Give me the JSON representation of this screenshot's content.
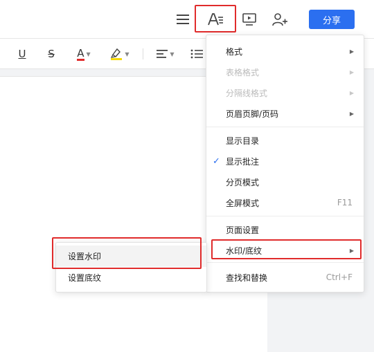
{
  "topbar": {
    "icons": [
      "menu-icon",
      "text-format-icon",
      "presentation-icon",
      "add-collaborator-icon"
    ],
    "share_label": "分享"
  },
  "format_toolbar": {
    "icons": [
      "underline-icon",
      "strikethrough-icon",
      "font-color-icon",
      "highlight-color-icon",
      "align-icon",
      "bullet-list-icon"
    ],
    "underline_glyph": "U",
    "strike_glyph": "S",
    "font_color_glyph": "A",
    "font_color": "#e02b2b",
    "highlight_color": "#f5d90a"
  },
  "menu": {
    "items": [
      {
        "label": "格式",
        "disabled": false,
        "submenu": true
      },
      {
        "label": "表格格式",
        "disabled": true,
        "submenu": true
      },
      {
        "label": "分隔线格式",
        "disabled": true,
        "submenu": true
      },
      {
        "label": "页眉页脚/页码",
        "disabled": false,
        "submenu": true
      },
      {
        "label": "显示目录",
        "disabled": false
      },
      {
        "label": "显示批注",
        "disabled": false,
        "checked": true
      },
      {
        "label": "分页模式",
        "disabled": false
      },
      {
        "label": "全屏模式",
        "disabled": false,
        "shortcut": "F11"
      },
      {
        "label": "页面设置",
        "disabled": false
      },
      {
        "label": "水印/底纹",
        "disabled": false,
        "submenu": true
      },
      {
        "label": "查找和替换",
        "disabled": false,
        "shortcut": "Ctrl+F"
      }
    ]
  },
  "submenu": {
    "items": [
      {
        "label": "设置水印"
      },
      {
        "label": "设置底纹"
      }
    ]
  },
  "colors": {
    "accent": "#2b6ff0",
    "highlight_box": "#e02b2b"
  }
}
